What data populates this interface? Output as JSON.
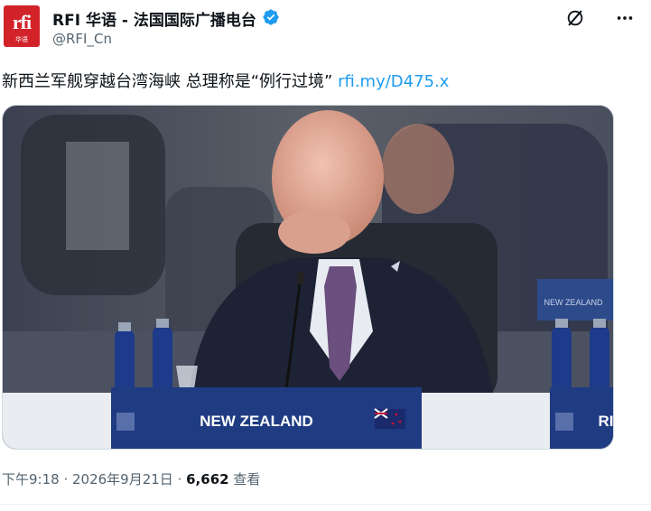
{
  "author": {
    "name": "RFI 华语 - 法国国际广播电台",
    "handle": "@RFI_Cn",
    "avatar_text": "rfi",
    "avatar_subtext": "华语"
  },
  "icons": {
    "verified": "verified-badge-icon",
    "grok": "grok-icon",
    "more": "more-options-icon"
  },
  "tweet": {
    "text": "新西兰军舰穿越台湾海峡 总理称是“例行过境” ",
    "link": "rfi.my/D475.x"
  },
  "photo": {
    "nameplate": "NEW ZEALAND",
    "nameplate_right": "RI",
    "sign_back": "NEW ZEALAND"
  },
  "meta": {
    "time": "下午9:18",
    "sep1": " · ",
    "date": "2026年9月21日",
    "sep2": " · ",
    "views": "6,662",
    "views_label": " 查看"
  },
  "colors": {
    "link": "#1d9bf0",
    "secondary_text": "#536471",
    "verified": "#1d9bf0",
    "rfi_red": "#d2232a"
  }
}
